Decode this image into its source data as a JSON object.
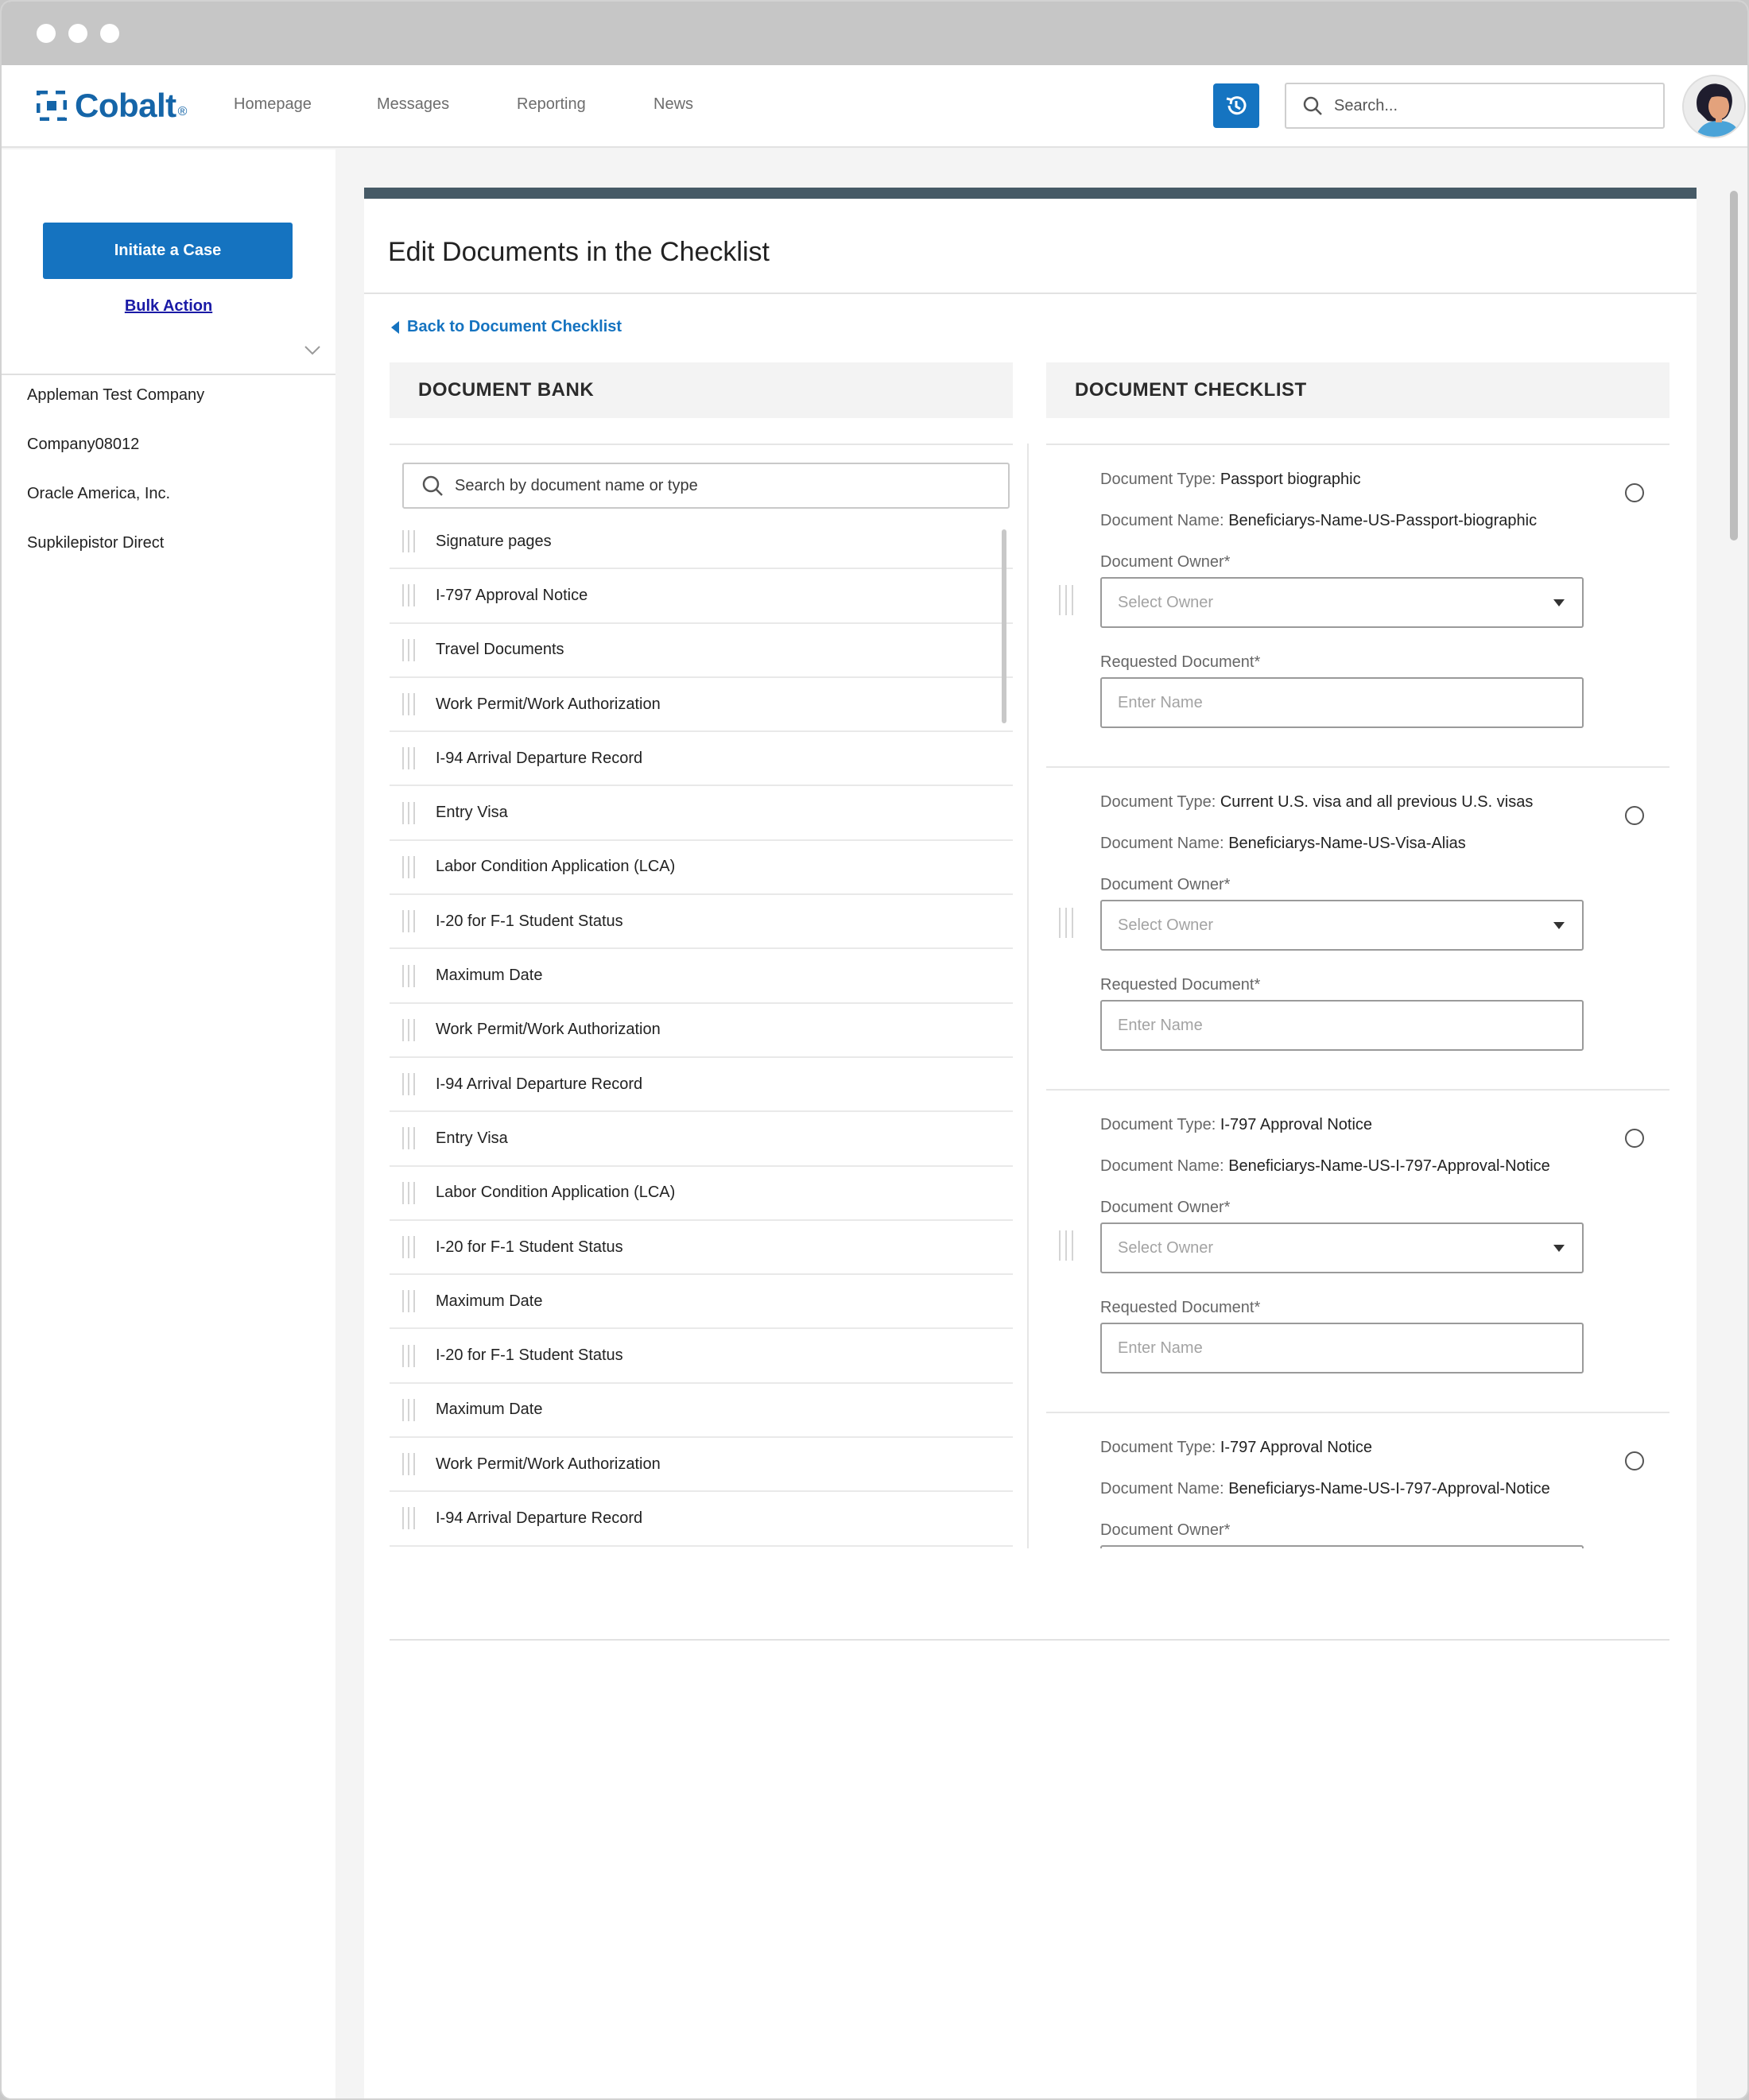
{
  "nav": {
    "brand": "Cobalt",
    "brand_mark": "®",
    "links": [
      "Homepage",
      "Messages",
      "Reporting",
      "News"
    ],
    "search_placeholder": "Search...",
    "accent": "#1573c0"
  },
  "sidebar": {
    "initiate_label": "Initiate a Case",
    "bulk_label": "Bulk Action",
    "companies": [
      "Appleman Test Company",
      "Company08012",
      "Oracle America, Inc.",
      "Supkilepistor Direct"
    ]
  },
  "main": {
    "title": "Edit Documents in the Checklist",
    "back_label": "Back to Document Checklist",
    "bank_header": "DOCUMENT BANK",
    "checklist_header": "DOCUMENT CHECKLIST",
    "bank_search_placeholder": "Search by document name or type",
    "bank_items": [
      "Signature pages",
      "I-797 Approval Notice",
      "Travel Documents",
      "Work Permit/Work Authorization",
      "I-94 Arrival Departure Record",
      "Entry Visa",
      "Labor Condition Application (LCA)",
      "I-20 for F-1 Student Status",
      "Maximum Date",
      "Work Permit/Work Authorization",
      "I-94 Arrival Departure Record",
      "Entry Visa",
      "Labor Condition Application (LCA)",
      "I-20 for F-1 Student Status",
      "Maximum Date",
      "I-20 for F-1 Student Status",
      "Maximum Date",
      "Work Permit/Work Authorization",
      "I-94 Arrival Departure Record"
    ],
    "checklist": {
      "type_label": "Document Type:",
      "name_label": "Document Name:",
      "owner_label": "Document Owner*",
      "owner_placeholder": "Select Owner",
      "requested_label": "Requested Document*",
      "requested_placeholder": "Enter Name",
      "items": [
        {
          "type": "Passport biographic",
          "name": "Beneficiarys-Name-US-Passport-biographic"
        },
        {
          "type": "Current U.S. visa and all previous U.S. visas",
          "name": "Beneficiarys-Name-US-Visa-Alias"
        },
        {
          "type": "I-797 Approval Notice",
          "name": "Beneficiarys-Name-US-I-797-Approval-Notice"
        },
        {
          "type": "I-797 Approval Notice",
          "name": "Beneficiarys-Name-US-I-797-Approval-Notice"
        }
      ]
    }
  }
}
